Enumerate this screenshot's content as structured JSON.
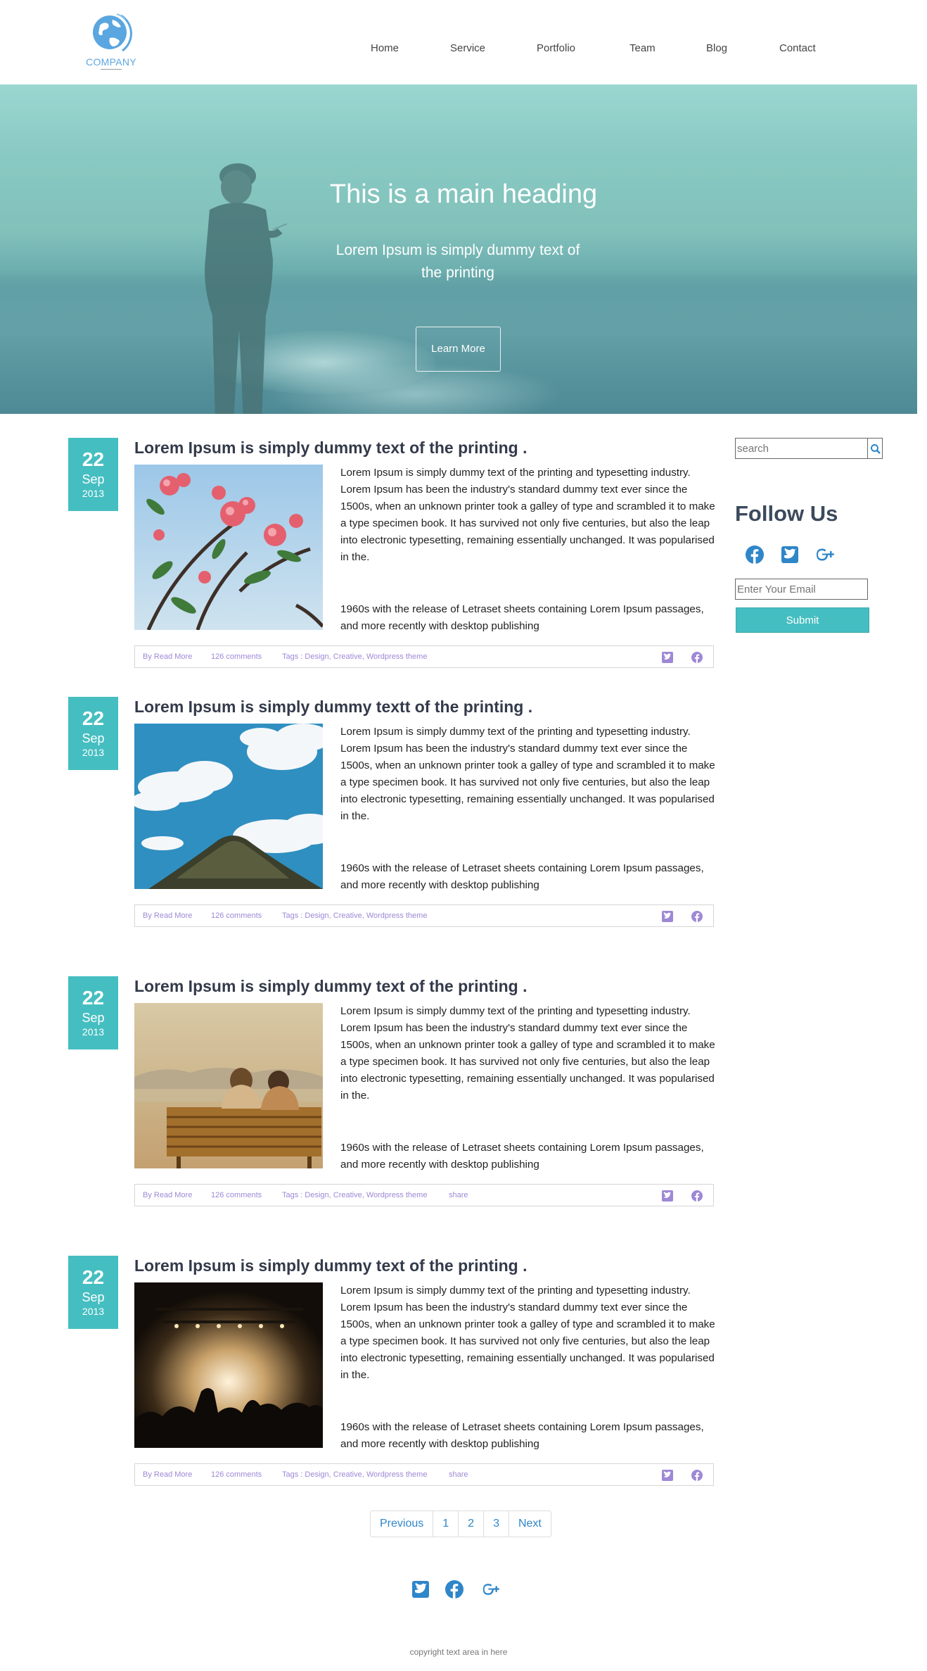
{
  "brand": {
    "name": "COMPANY",
    "accent": "#45bec1",
    "link": "#9e88d6"
  },
  "nav": {
    "items": [
      {
        "label": "Home"
      },
      {
        "label": "Service"
      },
      {
        "label": "Portfolio"
      },
      {
        "label": "Team"
      },
      {
        "label": "Blog"
      },
      {
        "label": "Contact"
      }
    ]
  },
  "hero": {
    "title": "This is a main heading",
    "subtitle": "Lorem Ipsum is simply dummy text of the printing",
    "button": "Learn More"
  },
  "posts": [
    {
      "day": "22",
      "month": "Sep",
      "year": "2013",
      "title": "Lorem Ipsum is simply dummy text of the printing .",
      "image": "flowers-photo",
      "body": "Lorem Ipsum is simply dummy text of the printing and typesetting industry. Lorem Ipsum has been the industry's standard dummy text ever since the 1500s, when an unknown printer took a galley of type and scrambled it to make a type specimen book. It has survived not only five centuries, but also the leap into electronic typesetting, remaining essentially unchanged. It was popularised in the.",
      "body2": "1960s with the release of Letraset sheets containing Lorem Ipsum passages, and more recently with desktop publishing",
      "author": "By Read More",
      "comments": "126 comments",
      "tags": "Tags : Design, Creative, Wordpress theme",
      "share": ""
    },
    {
      "day": "22",
      "month": "Sep",
      "year": "2013",
      "title": "Lorem Ipsum is simply dummy textt of the printing .",
      "image": "sky-hill-photo",
      "body": "Lorem Ipsum is simply dummy text of the printing and typesetting industry. Lorem Ipsum has been the industry's standard dummy text ever since the 1500s, when an unknown printer took a galley of type and scrambled it to make a type specimen book. It has survived not only five centuries, but also the leap into electronic typesetting, remaining essentially unchanged. It was popularised in the.",
      "body2": "1960s with the release of Letraset sheets containing Lorem Ipsum passages, and more recently with desktop publishing",
      "author": "By Read More",
      "comments": "126 comments",
      "tags": "Tags : Design, Creative, Wordpress theme",
      "share": ""
    },
    {
      "day": "22",
      "month": "Sep",
      "year": "2013",
      "title": "Lorem Ipsum is simply dummy text of the printing .",
      "image": "bench-couple-photo",
      "body": "Lorem Ipsum is simply dummy text of the printing and typesetting industry. Lorem Ipsum has been the industry's standard dummy text ever since the 1500s, when an unknown printer took a galley of type and scrambled it to make a type specimen book. It has survived not only five centuries, but also the leap into electronic typesetting, remaining essentially unchanged. It was popularised in the.",
      "body2": "1960s with the release of Letraset sheets containing Lorem Ipsum passages, and more recently with desktop publishing",
      "author": "By Read More",
      "comments": "126 comments",
      "tags": "Tags : Design, Creative, Wordpress theme",
      "share": "share"
    },
    {
      "day": "22",
      "month": "Sep",
      "year": "2013",
      "title": "Lorem Ipsum is simply dummy text of the printing .",
      "image": "concert-photo",
      "body": "Lorem Ipsum is simply dummy text of the printing and typesetting industry. Lorem Ipsum has been the industry's standard dummy text ever since the 1500s, when an unknown printer took a galley of type and scrambled it to make a type specimen book. It has survived not only five centuries, but also the leap into electronic typesetting, remaining essentially unchanged. It was popularised in the.",
      "body2": "1960s with the release of Letraset sheets containing Lorem Ipsum passages, and more recently with desktop publishing",
      "author": "By Read More",
      "comments": "126 comments",
      "tags": "Tags : Design, Creative, Wordpress theme",
      "share": "share"
    }
  ],
  "sidebar": {
    "search_placeholder": "search",
    "follow_title": "Follow Us",
    "email_placeholder": "Enter Your Email",
    "submit": "Submit",
    "social_icons": [
      "facebook-icon",
      "twitter-icon",
      "google-plus-icon"
    ]
  },
  "pagination": {
    "prev": "Previous",
    "pages": [
      "1",
      "2",
      "3"
    ],
    "next": "Next"
  },
  "footer": {
    "social_icons": [
      "twitter-icon",
      "facebook-icon",
      "google-plus-icon"
    ],
    "copyright": "copyright text area in here"
  }
}
